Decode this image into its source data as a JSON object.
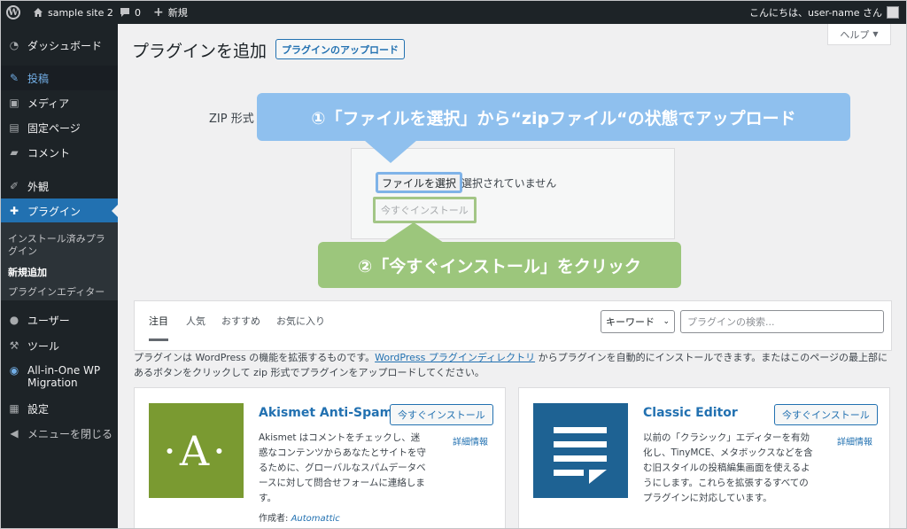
{
  "adminbar": {
    "site_name": "sample site 2",
    "comments_count": "0",
    "new_label": "新規",
    "greeting": "こんにちは、user-name さん"
  },
  "sidebar": {
    "items": [
      {
        "label": "ダッシュボード",
        "icon": "dashboard-icon"
      },
      {
        "label": "投稿",
        "icon": "pin-icon"
      },
      {
        "label": "メディア",
        "icon": "media-icon"
      },
      {
        "label": "固定ページ",
        "icon": "page-icon"
      },
      {
        "label": "コメント",
        "icon": "comment-icon"
      },
      {
        "label": "外観",
        "icon": "brush-icon"
      },
      {
        "label": "プラグイン",
        "icon": "plug-icon"
      },
      {
        "label": "ユーザー",
        "icon": "user-icon"
      },
      {
        "label": "ツール",
        "icon": "wrench-icon"
      },
      {
        "label": "All-in-One WP Migration",
        "icon": "migration-icon"
      },
      {
        "label": "設定",
        "icon": "settings-icon"
      },
      {
        "label": "メニューを閉じる",
        "icon": "collapse-icon"
      }
    ],
    "submenu": [
      "インストール済みプラグイン",
      "新規追加",
      "プラグインエディター"
    ]
  },
  "page": {
    "title": "プラグインを追加",
    "upload_button": "プラグインのアップロード",
    "help_label": "ヘルプ",
    "zip_label": "ZIP 形式",
    "file_button": "ファイルを選択",
    "no_file_text": "選択されていません",
    "install_now_button": "今すぐインストール"
  },
  "callouts": {
    "step1": "①「ファイルを選択」から“zipファイル“の状態でアップロード",
    "step2": "②「今すぐインストール」をクリック"
  },
  "filter": {
    "tabs": [
      "注目",
      "人気",
      "おすすめ",
      "お気に入り"
    ],
    "select_value": "キーワード",
    "search_placeholder": "プラグインの検索..."
  },
  "description": {
    "before": "プラグインは WordPress の機能を拡張するものです。",
    "link": "WordPress プラグインディレクトリ",
    "after": " からプラグインを自動的にインストールできます。またはこのページの最上部にあるボタンをクリックして zip 形式でプラグインをアップロードしてください。"
  },
  "plugins": [
    {
      "name": "Akismet Anti-Spam",
      "logo_text": "·A·",
      "install_label": "今すぐインストール",
      "details_label": "詳細情報",
      "description": "Akismet はコメントをチェックし、迷惑なコンテンツからあなたとサイトを守るために、グローバルなスパムデータベースに対して問合せフォームに連絡します。",
      "author_label": "作成者: ",
      "author": "Automattic",
      "color": "#7a9a31"
    },
    {
      "name": "Classic Editor",
      "install_label": "今すぐインストール",
      "details_label": "詳細情報",
      "description": "以前の「クラシック」エディターを有効化し、TinyMCE、メタボックスなどを含む旧スタイルの投稿編集画面を使えるようにします。これらを拡張するすべてのプラグインに対応しています。",
      "color": "#1e6293"
    }
  ],
  "colors": {
    "accent": "#2271b1",
    "admin_dark": "#1d2327",
    "callout_blue": "#8fc0ee",
    "callout_green": "#9cc67c"
  }
}
